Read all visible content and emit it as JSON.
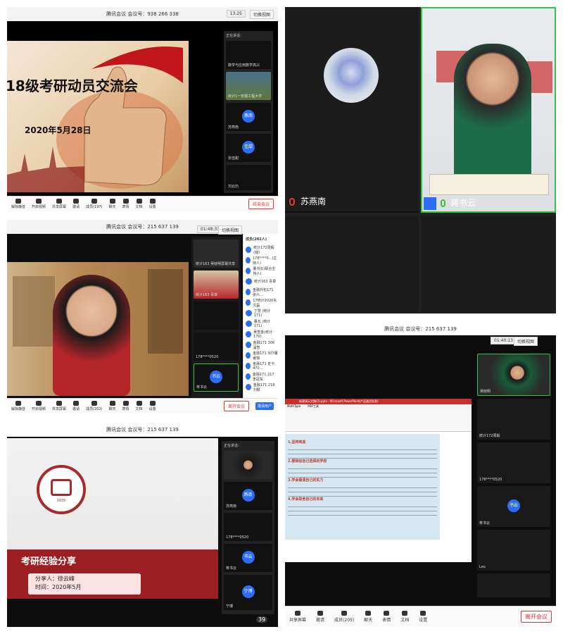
{
  "p1": {
    "meeting_id": "腾讯会议 会议号：938 266 338",
    "timer": "13:25",
    "switch_view": "切换视图",
    "slide_title": "18级考研动员交流会",
    "slide_date": "2020年5月28日",
    "side_header": "正在讲话：",
    "tiles": [
      {
        "name": "数学与应用数学高兴",
        "avatar": ""
      },
      {
        "name": "统计1一安徽工程大学",
        "avatar": ""
      },
      {
        "name": "苏燕南",
        "avatar": "燕南"
      },
      {
        "name": "张佳甜",
        "avatar": "佳甜"
      },
      {
        "name": "刘云仍",
        "avatar": ""
      }
    ],
    "toolbar": [
      "解除静音",
      "开启视频",
      "共享屏幕",
      "邀请",
      "成员(197)",
      "聊天",
      "表情",
      "文档",
      "设置"
    ],
    "leave": "结束会议"
  },
  "p2": {
    "names": [
      "苏燕南",
      "蒋书云"
    ]
  },
  "p3": {
    "meeting_id": "腾讯会议 会议号：215 637 139",
    "timer": "01:48:31",
    "switch_view": "切换视图",
    "members_title": "成员(202人)",
    "members": [
      "统计172周毅(我)",
      "178****0...(主持人)",
      "董书云(联合主持人)",
      "统计163 青章",
      "金融外包171 张六...",
      "17统计2020失文磊",
      "丁慧 (统计171)",
      "董瓦 (统计171)",
      "吴雪金(统计170)",
      "金融171 306 温智",
      "金融171 307董睿琪",
      "金融171 史卡470...",
      "金融171 217 李冠军",
      "金融171 218刘颖",
      "金融171 301张土琪",
      "金融171 303 王嘉慧"
    ],
    "tiles": [
      {
        "name": "统计163 吴晓明屏幕共享",
        "avatar": ""
      },
      {
        "name": "统计163 青章",
        "avatar": ""
      },
      {
        "name": "",
        "avatar": ""
      },
      {
        "name": "",
        "avatar": ""
      },
      {
        "name": "178****0520",
        "avatar": ""
      },
      {
        "name": "蒋书云",
        "avatar": "书云"
      }
    ],
    "toolbar": [
      "解除静音",
      "开启视频",
      "共享屏幕",
      "邀请",
      "成员(202)",
      "聊天",
      "表情",
      "文档",
      "设置"
    ],
    "leave": "离开会议",
    "invite": "邀请用户"
  },
  "p4": {
    "meeting_id": "腾讯会议 会议号：215 637 139",
    "timer": "01:40:13",
    "switch_view": "切换视图",
    "ppt_title": "新建演示文稿(2).pptx - Microsoft PowerPoint(产品激活失败)",
    "ppt_tab": "PDF工具",
    "ppt_tab2": "MathType",
    "slide_heads": [
      "1.坚持到底",
      "2.要相信自己选择的学校",
      "3.学会看清自己的实力",
      "4.学会取舍自己的未来"
    ],
    "tiles": [
      {
        "name": "吴晓明",
        "avatar": ""
      },
      {
        "name": "统计172周毅",
        "avatar": ""
      },
      {
        "name": "178****0520",
        "avatar": ""
      },
      {
        "name": "蒋书云",
        "avatar": "书云"
      },
      {
        "name": "Leo",
        "avatar": ""
      },
      {
        "name": "",
        "avatar": ""
      }
    ],
    "toolbar": [
      "共享屏幕",
      "邀请",
      "成员(205)",
      "聊天",
      "表情",
      "文档",
      "设置"
    ],
    "leave": "离开会议"
  },
  "p5": {
    "meeting_id": "腾讯会议 会议号：215 637 139",
    "logo_text": "ANHUI POLYTECHNIC UNIVERSITY",
    "logo_year": "1935",
    "slide_title": "考研经验分享",
    "sharer": "分享人：徐云峰",
    "time": "时间：2020年5月",
    "side_header": "正在讲话：",
    "tiles": [
      {
        "name": "",
        "avatar": ""
      },
      {
        "name": "苏燕南",
        "avatar": "燕南"
      },
      {
        "name": "178****0520",
        "avatar": ""
      },
      {
        "name": "蒋书云",
        "avatar": "书云"
      },
      {
        "name": "宁博",
        "avatar": "宁博"
      }
    ],
    "counter": "39"
  }
}
